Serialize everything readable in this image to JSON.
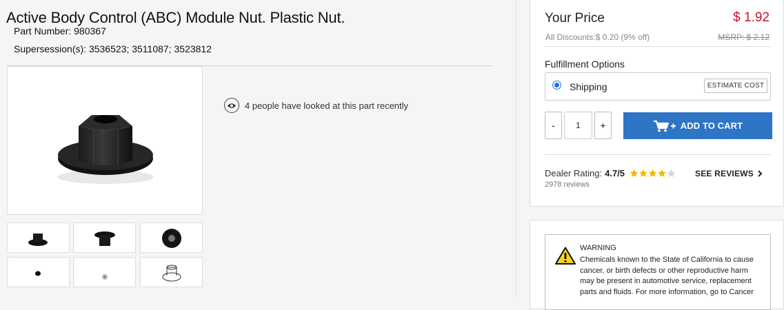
{
  "product": {
    "title": "Active Body Control (ABC) Module Nut. Plastic Nut.",
    "part_number_label": "Part Number:",
    "part_number": "980367",
    "supersession_label": "Supersession(s):",
    "supersession": "3536523; 3511087; 3523812",
    "views_text": "4 people have looked at this part recently"
  },
  "pricing": {
    "your_price_label": "Your Price",
    "price": "$ 1.92",
    "discounts_text": "All Discounts:$ 0.20 (9% off)",
    "msrp_text": "MSRP: $ 2.12"
  },
  "fulfillment": {
    "label": "Fulfillment Options",
    "option": "Shipping",
    "estimate_button": "ESTIMATE COST"
  },
  "cart": {
    "minus": "-",
    "quantity": "1",
    "plus": "+",
    "add_to_cart": "ADD TO CART"
  },
  "dealer": {
    "label": "Dealer Rating:",
    "score": "4.7/5",
    "rating_value": 4.7,
    "reviews_count": "2978 reviews",
    "see_reviews": "SEE REVIEWS"
  },
  "warning": {
    "heading": "WARNING",
    "text": "Chemicals known to the State of California to cause cancer, or birth defects or other reproductive harm may be present in automotive service, replacement parts and fluids. For more information, go to Cancer"
  },
  "colors": {
    "price_red": "#c8102e",
    "cart_blue": "#2f75c6",
    "radio_blue": "#1a73e8",
    "star_gold": "#f2b705"
  },
  "icons": [
    "eye-icon",
    "cart-plus-icon",
    "star-icon",
    "chevron-right-icon",
    "warning-triangle-icon"
  ]
}
